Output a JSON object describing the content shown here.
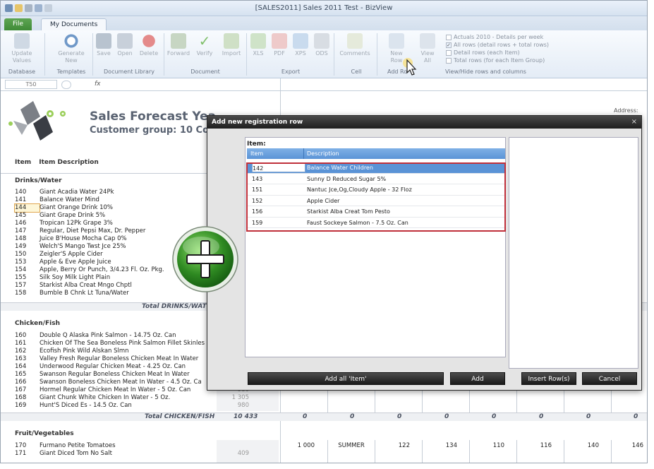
{
  "window": {
    "title": "[SALES2011] Sales 2011 Test - BizView"
  },
  "tabs": [
    {
      "label": "File"
    },
    {
      "label": "My Documents"
    }
  ],
  "ribbon": {
    "buttons": {
      "update_values": "Update\nValues",
      "generate_new": "Generate\nNew",
      "save": "Save",
      "open": "Open",
      "delete": "Delete",
      "forward": "Forward",
      "verify": "Verify",
      "import": "Import",
      "xls": "XLS",
      "pdf": "PDF",
      "xps": "XPS",
      "ods": "ODS",
      "comments": "Comments",
      "new_row": "New\nRow",
      "view_all": "View\nAll"
    },
    "groups": {
      "database": "Database",
      "templates": "Templates",
      "document_library": "Document Library",
      "document": "Document",
      "export": "Export",
      "cell": "Cell",
      "add_row": "Add Ro",
      "view_hide": "View/Hide rows and columns"
    },
    "options": [
      {
        "label": "Actuals 2010 - Details per week",
        "checked": false
      },
      {
        "label": "All rows (detail rows + total rows)",
        "checked": true
      },
      {
        "label": "Detail rows (each Item)",
        "checked": false
      },
      {
        "label": "Total rows (for each Item Group)",
        "checked": false
      }
    ]
  },
  "formula_bar": {
    "cell_ref": "T50",
    "fx": "fx"
  },
  "sheet": {
    "title1": "Sales Forecast Yea",
    "title2": "Customer group: 10 Co",
    "address_label": "Address:",
    "col_item": "Item",
    "col_desc": "Item Description",
    "sections": [
      {
        "name": "Drinks/Water",
        "rows": [
          {
            "num": "140",
            "desc": "Giant Acadia Water 24Pk"
          },
          {
            "num": "141",
            "desc": "Balance Water Mind"
          },
          {
            "num": "144",
            "desc": "Giant Orange Drink 10%"
          },
          {
            "num": "145",
            "desc": "Giant Grape Drink 5%"
          },
          {
            "num": "146",
            "desc": "Tropican 12Pk Grape 3%"
          },
          {
            "num": "147",
            "desc": "Regular, Diet Pepsi Max, Dr. Pepper"
          },
          {
            "num": "148",
            "desc": "Juice B'House Mocha Cap 0%"
          },
          {
            "num": "149",
            "desc": "Welch'S Mango Twst Jce 25%"
          },
          {
            "num": "150",
            "desc": "Zeigler'S Apple Cider"
          },
          {
            "num": "153",
            "desc": "Apple & Eve Apple Juice"
          },
          {
            "num": "154",
            "desc": "Apple, Berry Or Punch, 3/4.23 Fl. Oz. Pkg."
          },
          {
            "num": "155",
            "desc": "Silk Soy Milk Light Plain"
          },
          {
            "num": "157",
            "desc": "Starkist Alba Creat Mngo Chptl"
          },
          {
            "num": "158",
            "desc": "Bumble B Chnk Lt Tuna/Water"
          }
        ],
        "total_label": "Total DRINKS/WAT"
      },
      {
        "name": "Chicken/Fish",
        "rows": [
          {
            "num": "160",
            "desc": "Double Q Alaska Pink Salmon - 14.75 Oz. Can"
          },
          {
            "num": "161",
            "desc": "Chicken Of The Sea Boneless Pink Salmon Fillet Skinles"
          },
          {
            "num": "162",
            "desc": "Ecofish Pink Wild Alskan Slmn"
          },
          {
            "num": "163",
            "desc": "Valley Fresh Regular Boneless Chicken Meat In Water"
          },
          {
            "num": "164",
            "desc": "Underwood Regular Chicken Meat - 4.25 Oz. Can"
          },
          {
            "num": "165",
            "desc": "Swanson Regular Boneless Chicken Meat In Water"
          },
          {
            "num": "166",
            "desc": "Swanson Boneless Chicken Meat In Water - 4.5 Oz. Ca"
          },
          {
            "num": "167",
            "desc": "Hormel Regular Chicken Meat In Water - 5 Oz. Can"
          },
          {
            "num": "168",
            "desc": "Giant Chunk White Chicken In Water - 5 Oz."
          },
          {
            "num": "169",
            "desc": "Hunt'S Diced Es - 14.5 Oz. Can"
          }
        ],
        "total_label": "Total CHICKEN/FISH",
        "total_value": "10 433"
      },
      {
        "name": "Fruit/Vegetables",
        "rows": [
          {
            "num": "170",
            "desc": "Furmano Petite Tomatoes"
          },
          {
            "num": "171",
            "desc": "Giant Diced Tom No Salt"
          }
        ]
      }
    ],
    "grid_values": {
      "v980a": "980",
      "v1305": "1 305",
      "v980b": "980",
      "v409": "409",
      "zeros": [
        "0",
        "0",
        "0",
        "0",
        "0",
        "0",
        "0",
        "0"
      ],
      "fruit_row": [
        "1 000",
        "SUMMER",
        "122",
        "134",
        "110",
        "116",
        "140",
        "146"
      ]
    }
  },
  "dialog": {
    "title": "Add new registration row",
    "close": "×",
    "item_label": "Item:",
    "col_item": "Item",
    "col_desc": "Description",
    "rows": [
      {
        "code": "142",
        "desc": "Balance Water Children",
        "selected": true
      },
      {
        "code": "143",
        "desc": "Sunny D Reduced Sugar 5%"
      },
      {
        "code": "151",
        "desc": "Nantuc Jce,Og,Cloudy Apple - 32 Floz"
      },
      {
        "code": "152",
        "desc": "Apple Cider"
      },
      {
        "code": "156",
        "desc": "Starkist Alba Creat Tom Pesto"
      },
      {
        "code": "159",
        "desc": "Faust Sockeye Salmon - 7.5 Oz. Can"
      }
    ],
    "buttons": {
      "add_all": "Add all 'Item'",
      "add": "Add",
      "insert_rows": "Insert Row(s)",
      "cancel": "Cancel"
    }
  }
}
